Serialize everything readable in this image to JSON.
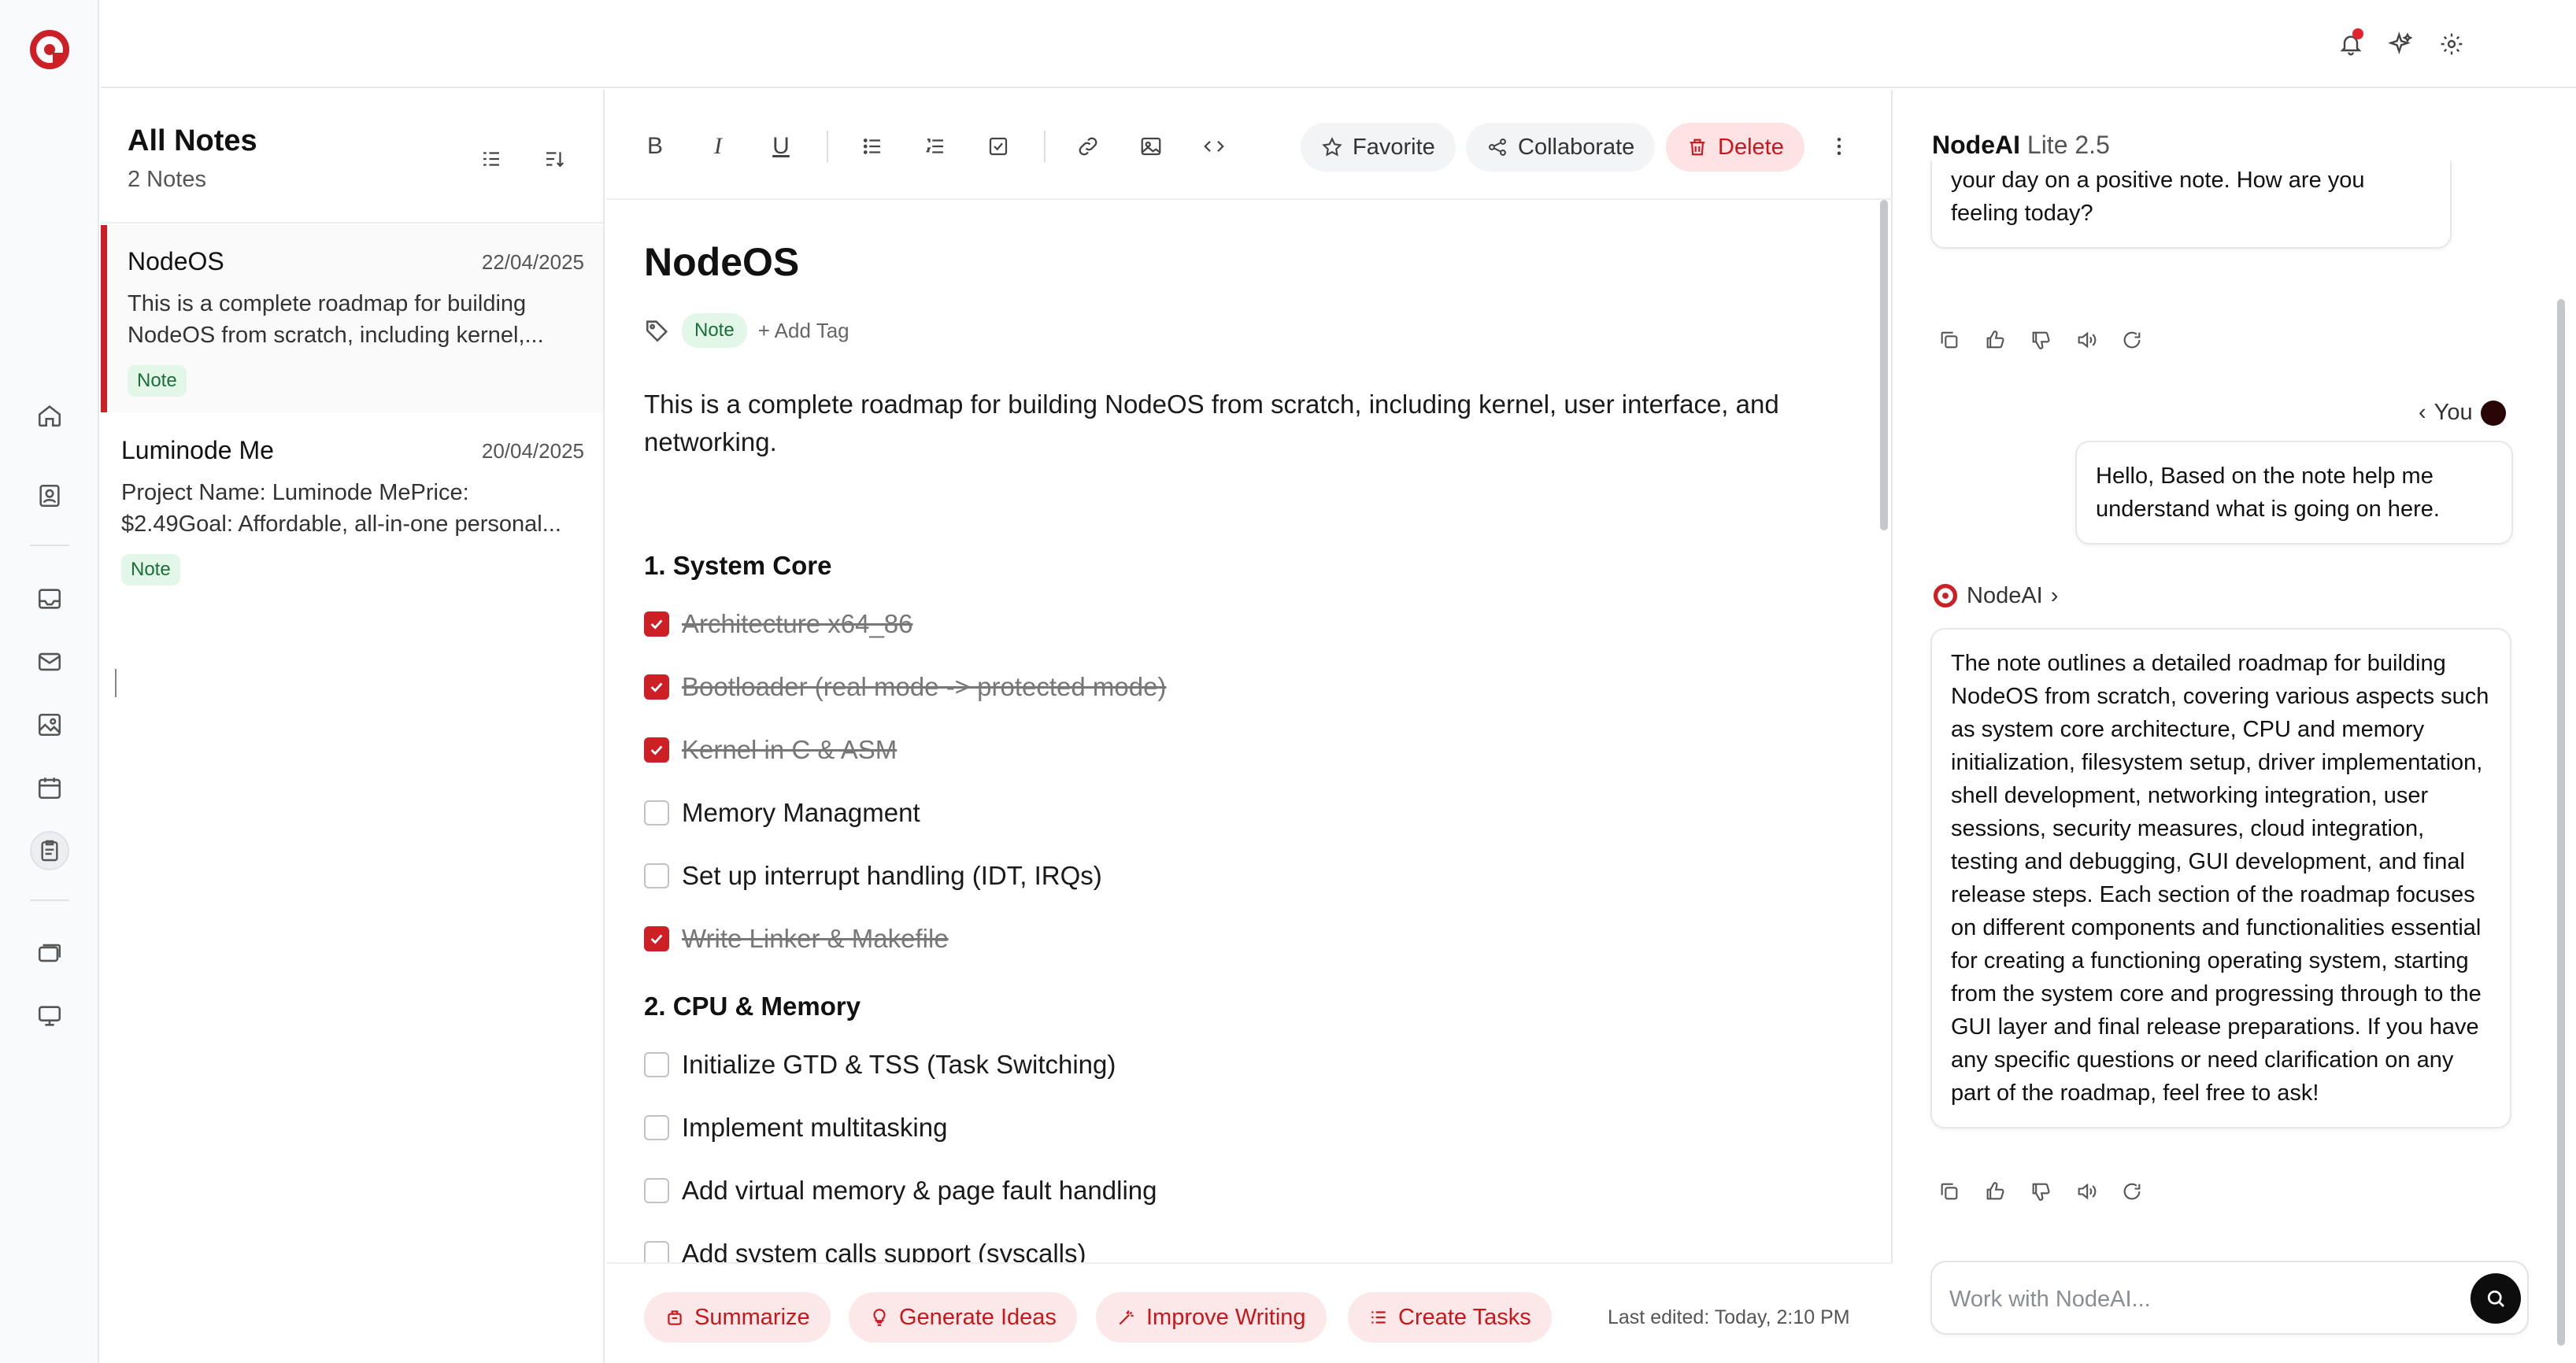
{
  "colors": {
    "accent": "#cc1f26",
    "tag_bg": "#e2f7e8",
    "tag_fg": "#1a6e38",
    "danger_bg": "#fde3e3"
  },
  "rail": {
    "icons": [
      "home-icon",
      "contacts-icon",
      "inbox-icon",
      "mail-icon",
      "gallery-icon",
      "calendar-icon",
      "notes-icon",
      "stack-icon",
      "monitor-icon"
    ],
    "active": "notes-icon"
  },
  "topbar": {
    "icons": [
      "bell-icon",
      "sparkles-icon",
      "gear-icon"
    ]
  },
  "notes_list": {
    "title": "All Notes",
    "count": "2 Notes",
    "items": [
      {
        "title": "NodeOS",
        "date": "22/04/2025",
        "preview": "This is a complete roadmap for building NodeOS from scratch, including kernel,...",
        "tag": "Note"
      },
      {
        "title": "Luminode Me",
        "date": "20/04/2025",
        "preview": "Project Name: Luminode MePrice: $2.49Goal: Affordable, all-in-one personal...",
        "tag": "Note"
      }
    ]
  },
  "toolbar": {
    "bold": "B",
    "italic": "I",
    "underline": "U",
    "favorite": "Favorite",
    "collaborate": "Collaborate",
    "delete": "Delete"
  },
  "note": {
    "title": "NodeOS",
    "tag": "Note",
    "add_tag": "+ Add Tag",
    "intro": "This is a complete roadmap for building NodeOS from scratch, including kernel, user interface, and networking.",
    "sections": [
      {
        "heading": "1. System Core",
        "tasks": [
          {
            "text": "Architecture x64_86",
            "done": true
          },
          {
            "text": "Bootloader (real mode -> protected mode)",
            "done": true
          },
          {
            "text": "Kernel in C & ASM",
            "done": true
          },
          {
            "text": "Memory Managment",
            "done": false
          },
          {
            "text": "Set up interrupt handling (IDT, IRQs)",
            "done": false
          },
          {
            "text": "Write Linker & Makefile",
            "done": true
          }
        ]
      },
      {
        "heading": "2. CPU & Memory",
        "tasks": [
          {
            "text": "Initialize GTD & TSS (Task Switching)",
            "done": false
          },
          {
            "text": "Implement multitasking",
            "done": false
          },
          {
            "text": "Add virtual memory & page fault handling",
            "done": false
          },
          {
            "text": "Add system calls support (syscalls)",
            "done": false
          }
        ]
      }
    ]
  },
  "footer": {
    "summarize": "Summarize",
    "generate": "Generate Ideas",
    "improve": "Improve Writing",
    "tasks": "Create Tasks",
    "last_edited": "Last edited: Today, 2:10 PM"
  },
  "ai": {
    "name": "NodeAI",
    "version": "Lite 2.5",
    "greeting_tail": "your day on a positive note. How are you feeling today?",
    "you_label": "You",
    "user_message": "Hello, Based on the note help me understand what is going on here.",
    "bot_label": "NodeAI",
    "response": "The note outlines a detailed roadmap for building NodeOS from scratch, covering various aspects such as system core architecture, CPU and memory initialization, filesystem setup, driver implementation, shell development, networking integration, user sessions, security measures, cloud integration, testing and debugging, GUI development, and final release steps. Each section of the roadmap focuses on different components and functionalities essential for creating a functioning operating system, starting from the system core and progressing through to the GUI layer and final release preparations. If you have any specific questions or need clarification on any part of the roadmap, feel free to ask!",
    "input_placeholder": "Work with NodeAI..."
  }
}
